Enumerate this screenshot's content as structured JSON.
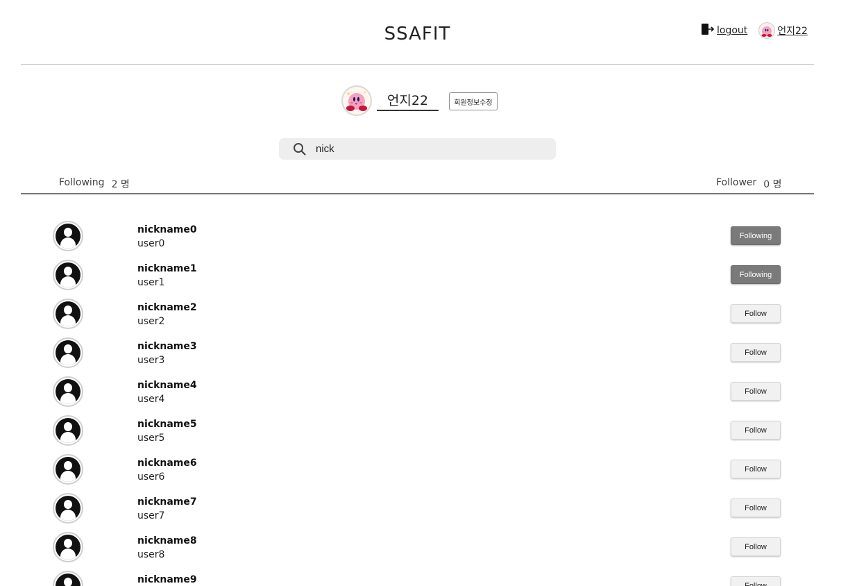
{
  "header": {
    "title": "SSAFIT",
    "logout_label": "logout",
    "user_label": "언지22"
  },
  "profile": {
    "name": "언지22",
    "edit_label": "회원정보수정"
  },
  "search": {
    "value": "nick",
    "icon": "search-icon"
  },
  "tabs": {
    "following_label": "Following",
    "following_count": "2 명",
    "follower_label": "Follower",
    "follower_count": "0 명"
  },
  "users": [
    {
      "nickname": "nickname0",
      "user_id": "user0",
      "button": "Following",
      "state": "following"
    },
    {
      "nickname": "nickname1",
      "user_id": "user1",
      "button": "Following",
      "state": "following"
    },
    {
      "nickname": "nickname2",
      "user_id": "user2",
      "button": "Follow",
      "state": "follow"
    },
    {
      "nickname": "nickname3",
      "user_id": "user3",
      "button": "Follow",
      "state": "follow"
    },
    {
      "nickname": "nickname4",
      "user_id": "user4",
      "button": "Follow",
      "state": "follow"
    },
    {
      "nickname": "nickname5",
      "user_id": "user5",
      "button": "Follow",
      "state": "follow"
    },
    {
      "nickname": "nickname6",
      "user_id": "user6",
      "button": "Follow",
      "state": "follow"
    },
    {
      "nickname": "nickname7",
      "user_id": "user7",
      "button": "Follow",
      "state": "follow"
    },
    {
      "nickname": "nickname8",
      "user_id": "user8",
      "button": "Follow",
      "state": "follow"
    },
    {
      "nickname": "nickname9",
      "user_id": "",
      "button": "Follow",
      "state": "follow"
    }
  ]
}
